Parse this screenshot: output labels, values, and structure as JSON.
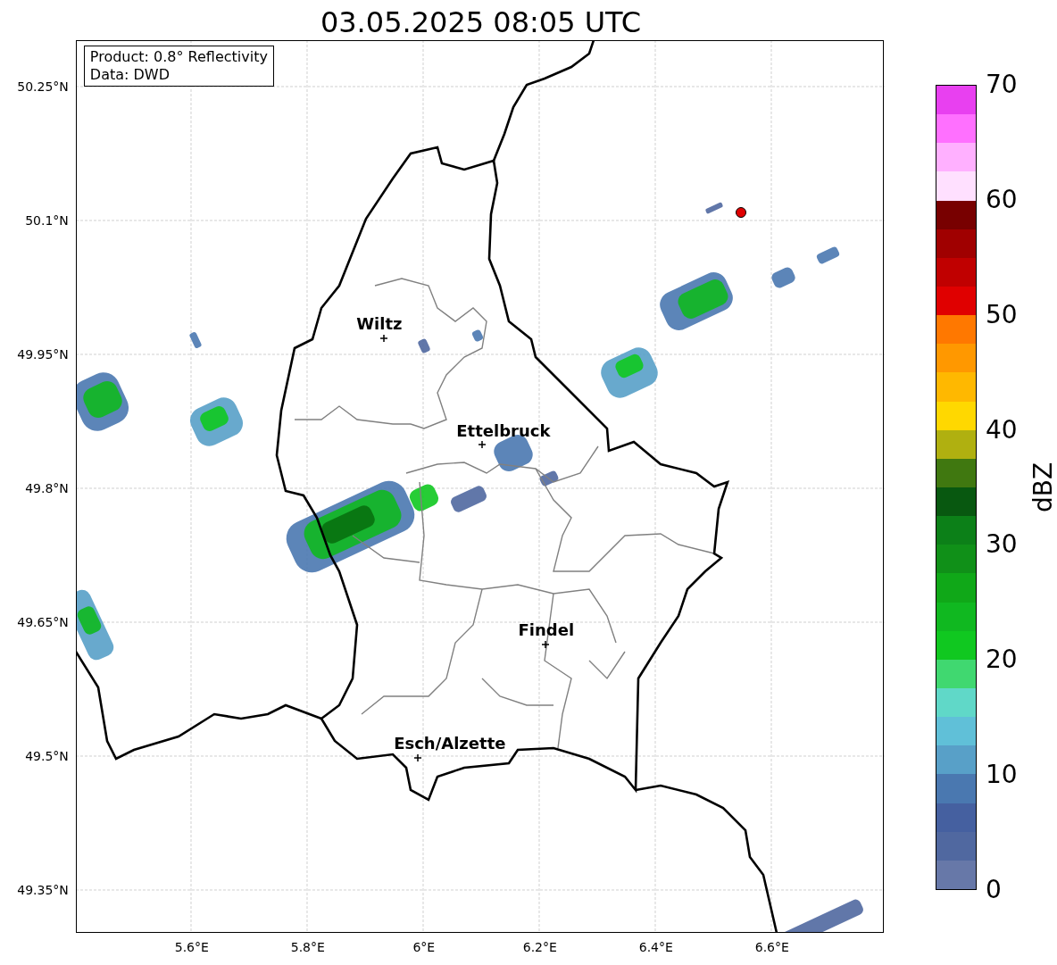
{
  "title": "03.05.2025 08:05 UTC",
  "info_box": {
    "lines": [
      "Product: 0.8° Reflectivity",
      "Data: DWD"
    ]
  },
  "map": {
    "lat_ticks": [
      "50.25°N",
      "50.1°N",
      "49.95°N",
      "49.8°N",
      "49.65°N",
      "49.5°N",
      "49.35°N"
    ],
    "lon_ticks": [
      "5.6°E",
      "5.8°E",
      "6°E",
      "6.2°E",
      "6.4°E",
      "6.6°E"
    ],
    "cities": [
      {
        "name": "Wiltz"
      },
      {
        "name": "Ettelbruck"
      },
      {
        "name": "Findel"
      },
      {
        "name": "Esch/Alzette"
      }
    ]
  },
  "colorbar": {
    "label": "dBZ",
    "ticks": [
      "70",
      "60",
      "50",
      "40",
      "30",
      "20",
      "10",
      "0"
    ],
    "segments": [
      {
        "color": "#6778a8"
      },
      {
        "color": "#5068a0"
      },
      {
        "color": "#4560a0"
      },
      {
        "color": "#4a78b0"
      },
      {
        "color": "#58a0c8"
      },
      {
        "color": "#60c0d8"
      },
      {
        "color": "#60d8c8"
      },
      {
        "color": "#40d870"
      },
      {
        "color": "#10c820"
      },
      {
        "color": "#10b820"
      },
      {
        "color": "#10a818"
      },
      {
        "color": "#109018"
      },
      {
        "color": "#0c8018"
      },
      {
        "color": "#085810"
      },
      {
        "color": "#407810"
      },
      {
        "color": "#b0b010"
      },
      {
        "color": "#ffd800"
      },
      {
        "color": "#ffb800"
      },
      {
        "color": "#ff9800"
      },
      {
        "color": "#ff7800"
      },
      {
        "color": "#e00000"
      },
      {
        "color": "#c00000"
      },
      {
        "color": "#a00000"
      },
      {
        "color": "#780000"
      },
      {
        "color": "#ffe0ff"
      },
      {
        "color": "#ffb0ff"
      },
      {
        "color": "#ff70ff"
      },
      {
        "color": "#e840f0"
      }
    ]
  }
}
